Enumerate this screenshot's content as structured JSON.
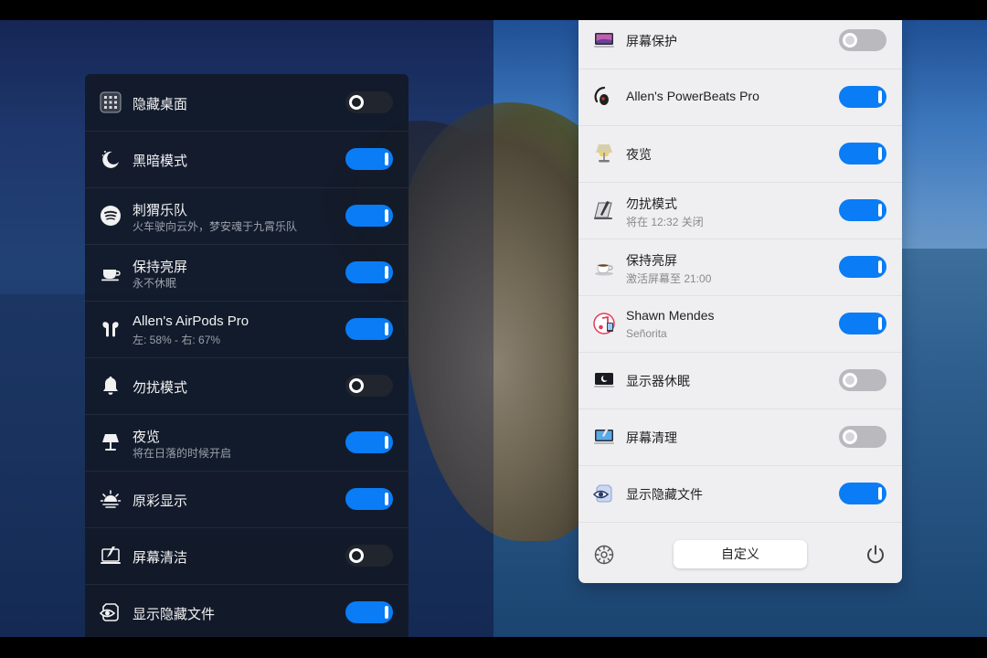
{
  "dark_panel": {
    "items": [
      {
        "title": "隐藏桌面",
        "subtitle": "",
        "icon": "grid-icon",
        "on": false
      },
      {
        "title": "黑暗模式",
        "subtitle": "",
        "icon": "moon-icon",
        "on": true
      },
      {
        "title": "刺猬乐队",
        "subtitle": "火车驶向云外，梦安魂于九霄乐队",
        "icon": "spotify-icon",
        "on": true
      },
      {
        "title": "保持亮屏",
        "subtitle": "永不休眠",
        "icon": "coffee-cup-icon",
        "on": true
      },
      {
        "title": "Allen's AirPods Pro",
        "subtitle": "左: 58% - 右: 67%",
        "icon": "airpods-icon",
        "on": true
      },
      {
        "title": "勿扰模式",
        "subtitle": "",
        "icon": "bell-icon",
        "on": false
      },
      {
        "title": "夜览",
        "subtitle": "将在日落的时候开启",
        "icon": "lamp-icon",
        "on": true
      },
      {
        "title": "原彩显示",
        "subtitle": "",
        "icon": "sun-icon",
        "on": true
      },
      {
        "title": "屏幕清洁",
        "subtitle": "",
        "icon": "screen-clean-icon",
        "on": false
      },
      {
        "title": "显示隐藏文件",
        "subtitle": "",
        "icon": "eye-icon",
        "on": true
      }
    ]
  },
  "light_panel": {
    "items": [
      {
        "title": "屏幕保护",
        "subtitle": "",
        "icon": "screensaver-icon",
        "on": false
      },
      {
        "title": "Allen's PowerBeats Pro",
        "subtitle": "",
        "icon": "earbud-icon",
        "on": true
      },
      {
        "title": "夜览",
        "subtitle": "",
        "icon": "lamp-icon",
        "on": true
      },
      {
        "title": "勿扰模式",
        "subtitle": "将在 12:32 关闭",
        "icon": "pen-tablet-icon",
        "on": true
      },
      {
        "title": "保持亮屏",
        "subtitle": "激活屏幕至 21:00",
        "icon": "coffee-cup-icon",
        "on": true
      },
      {
        "title": "Shawn Mendes",
        "subtitle": "Señorita",
        "icon": "music-icon",
        "on": true
      },
      {
        "title": "显示器休眠",
        "subtitle": "",
        "icon": "display-sleep-icon",
        "on": false
      },
      {
        "title": "屏幕清理",
        "subtitle": "",
        "icon": "screen-clean-icon",
        "on": false
      },
      {
        "title": "显示隐藏文件",
        "subtitle": "",
        "icon": "eye-icon",
        "on": true
      }
    ],
    "footer": {
      "customize_label": "自定义",
      "settings_icon": "gear-icon",
      "power_icon": "power-icon"
    }
  },
  "colors": {
    "accent": "#0a7cf5",
    "dark_panel_bg": "#121826",
    "light_panel_bg": "#efeff1"
  }
}
